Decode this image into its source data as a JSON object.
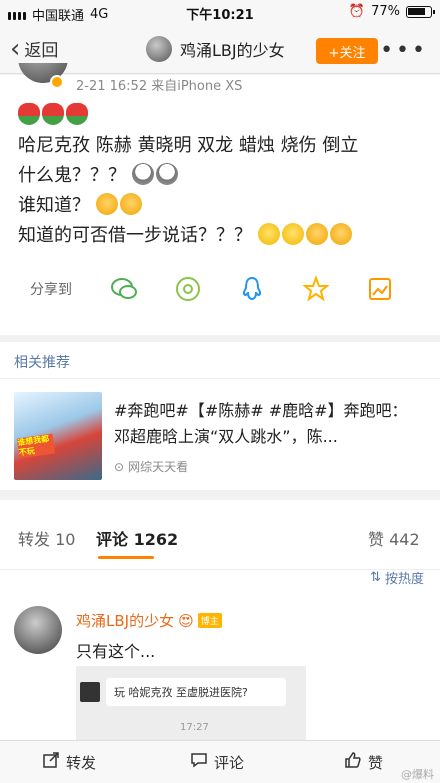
{
  "status_bar": {
    "carrier": "中国联通",
    "network": "4G",
    "time": "下午10:21",
    "battery": "77%"
  },
  "nav": {
    "back_label": "返回",
    "title": "鸡涌LBJ的少女",
    "follow_label": "+关注",
    "more_label": "•••"
  },
  "post": {
    "meta": "2-21 16:52  来自iPhone XS",
    "lines": [
      "哈尼克孜 陈赫 黄晓明 双龙 蜡烛 烧伤 倒立",
      "什么鬼？？？",
      "谁知道？",
      "知道的可否借一步说话？？？"
    ],
    "share_label": "分享到"
  },
  "related": {
    "title": "相关推荐",
    "text": "#奔跑吧#【#陈赫# #鹿晗#】奔跑吧：邓超鹿晗上演“双人跳水”，陈...",
    "source": "网综天天看",
    "thumb_tag": "谁想我都不玩"
  },
  "tabs": {
    "repost": "转发 10",
    "comment": "评论 1262",
    "like": "赞 442",
    "sort": "按热度"
  },
  "comment": {
    "name": "鸡涌LBJ的少女",
    "badge": "博主",
    "text": "只有这个...",
    "image_bubble": "玩  哈妮克孜 至虚脱进医院?",
    "image_time": "17:27"
  },
  "bottom_bar": {
    "repost": "转发",
    "comment": "评论",
    "like": "赞"
  },
  "watermark": "@爆料",
  "colors": {
    "accent": "#ff8200",
    "link": "#5a7aa6",
    "comment_name": "#e86b1c"
  }
}
